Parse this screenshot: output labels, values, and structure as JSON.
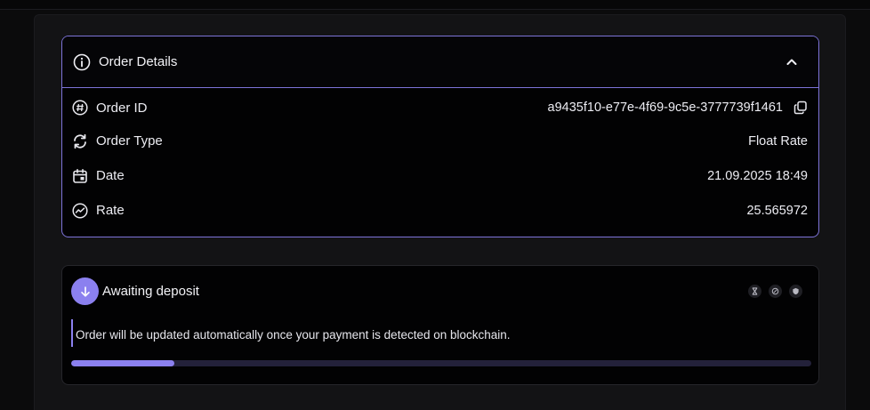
{
  "order_details": {
    "title": "Order Details",
    "rows": [
      {
        "label": "Order ID",
        "value": "a9435f10-e77e-4f69-9c5e-3777739f1461",
        "icon": "hash-icon"
      },
      {
        "label": "Order Type",
        "value": "Float Rate",
        "icon": "refresh-icon"
      },
      {
        "label": "Date",
        "value": "21.09.2025 18:49",
        "icon": "calendar-icon"
      },
      {
        "label": "Rate",
        "value": "25.565972",
        "icon": "trend-icon"
      }
    ]
  },
  "status": {
    "title": "Awaiting deposit",
    "message": "Order will be updated automatically once your payment is detected on blockchain.",
    "progress": 0.14
  },
  "colors": {
    "accent": "#8b80ef",
    "border_accent": "#7d73d8",
    "background": "#020203"
  }
}
